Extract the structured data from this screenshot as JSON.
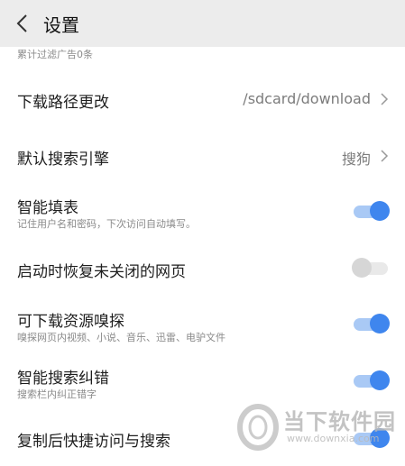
{
  "header": {
    "title": "设置",
    "back_icon": "chevron-left-icon"
  },
  "settings": {
    "ad_filter": {
      "subtitle": "累计过滤广告0条"
    },
    "download_path": {
      "label": "下载路径更改",
      "value": "/sdcard/download"
    },
    "search_engine": {
      "label": "默认搜索引擎",
      "value": "搜狗"
    },
    "smart_fill": {
      "label": "智能填表",
      "subtitle": "记住用户名和密码，下次访问自动填写。",
      "enabled": true
    },
    "restore_pages": {
      "label": "启动时恢复未关闭的网页",
      "enabled": false
    },
    "resource_sniff": {
      "label": "可下载资源嗅探",
      "subtitle": "嗅探网页内视频、小说、音乐、迅雷、电驴文件",
      "enabled": true
    },
    "search_correction": {
      "label": "智能搜索纠错",
      "subtitle": "搜索栏内纠正错字",
      "enabled": true
    },
    "quick_access": {
      "label": "复制后快捷访问与搜索",
      "enabled": true
    }
  },
  "watermark": {
    "brand": "当下软件园",
    "url": "www.downxia.com"
  },
  "colors": {
    "toggle_on_knob": "#3f86ee",
    "toggle_on_track": "#a9c9f5",
    "toggle_off_knob": "#d6d6d6",
    "header_bg": "#ececec"
  }
}
